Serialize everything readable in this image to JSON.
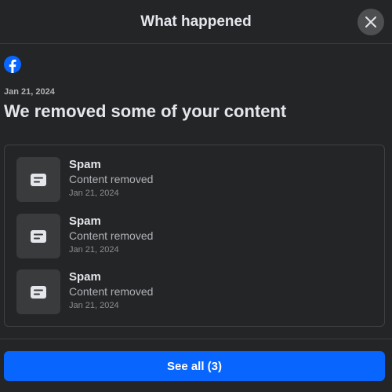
{
  "header": {
    "title": "What happened",
    "close_icon": "close-icon"
  },
  "logo": {
    "icon": "facebook-logo",
    "color": "#0866ff"
  },
  "notice": {
    "date": "Jan 21, 2024",
    "title": "We removed some of your content"
  },
  "items": [
    {
      "title": "Spam",
      "status": "Content removed",
      "date": "Jan 21, 2024",
      "icon": "post-icon"
    },
    {
      "title": "Spam",
      "status": "Content removed",
      "date": "Jan 21, 2024",
      "icon": "post-icon"
    },
    {
      "title": "Spam",
      "status": "Content removed",
      "date": "Jan 21, 2024",
      "icon": "post-icon"
    }
  ],
  "footer": {
    "see_all_label": "See all (3)",
    "button_color": "#0866ff"
  }
}
